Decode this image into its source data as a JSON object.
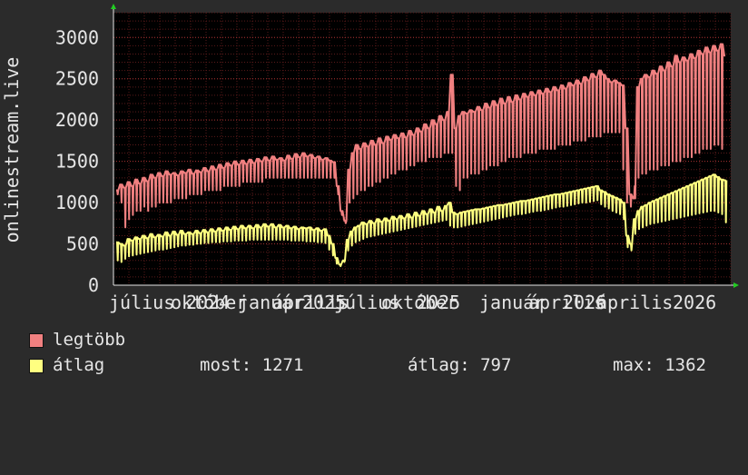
{
  "chart_data": {
    "type": "line",
    "ylabel": "onlinestream.live",
    "ylim": [
      0,
      3300
    ],
    "yticks": [
      0,
      500,
      1000,
      1500,
      2000,
      2500,
      3000
    ],
    "x_tick_labels": [
      "július",
      "október",
      "2024",
      "január",
      "április",
      "2025",
      "július",
      "október",
      "2025",
      "január",
      "április",
      "2026",
      "április",
      "2026"
    ],
    "grid": true,
    "series": [
      {
        "name": "legtöbb",
        "color": "#f08080",
        "values": [
          1150,
          1220,
          1180,
          1250,
          1200,
          1280,
          1230,
          1300,
          1260,
          1340,
          1300,
          1360,
          1320,
          1380,
          1340,
          1360,
          1330,
          1380,
          1360,
          1400,
          1350,
          1390,
          1370,
          1420,
          1380,
          1440,
          1400,
          1460,
          1420,
          1480,
          1450,
          1500,
          1460,
          1510,
          1470,
          1520,
          1480,
          1530,
          1500,
          1550,
          1510,
          1560,
          1520,
          1540,
          1510,
          1570,
          1530,
          1590,
          1550,
          1600,
          1560,
          1580,
          1540,
          1560,
          1520,
          1540,
          1510,
          1490,
          1200,
          900,
          780,
          1400,
          1600,
          1700,
          1650,
          1720,
          1680,
          1750,
          1700,
          1780,
          1720,
          1800,
          1760,
          1820,
          1780,
          1840,
          1790,
          1870,
          1820,
          1900,
          1860,
          1950,
          1900,
          2000,
          1950,
          2050,
          2000,
          2100,
          2550,
          1900,
          2050,
          2100,
          2080,
          2120,
          2100,
          2160,
          2120,
          2200,
          2150,
          2230,
          2180,
          2260,
          2200,
          2280,
          2220,
          2300,
          2250,
          2320,
          2280,
          2340,
          2300,
          2360,
          2320,
          2380,
          2340,
          2400,
          2360,
          2420,
          2380,
          2450,
          2420,
          2480,
          2440,
          2520,
          2480,
          2560,
          2520,
          2600,
          2550,
          2500,
          2460,
          2480,
          2450,
          2420,
          1900,
          1100,
          1050,
          2400,
          2500,
          2550,
          2520,
          2600,
          2560,
          2650,
          2600,
          2700,
          2650,
          2780,
          2700,
          2760,
          2720,
          2800,
          2750,
          2840,
          2800,
          2880,
          2820,
          2900,
          2840,
          2920,
          2780
        ],
        "lows": [
          1100,
          1000,
          700,
          800,
          850,
          900,
          900,
          950,
          900,
          950,
          950,
          1000,
          1000,
          1000,
          1000,
          1050,
          1050,
          1050,
          1050,
          1100,
          1100,
          1100,
          1100,
          1150,
          1150,
          1150,
          1150,
          1150,
          1200,
          1200,
          1200,
          1200,
          1200,
          1250,
          1250,
          1250,
          1250,
          1250,
          1250,
          1300,
          1300,
          1300,
          1300,
          1300,
          1300,
          1300,
          1300,
          1300,
          1300,
          1300,
          1300,
          1300,
          1300,
          1300,
          1300,
          1300,
          1300,
          1300,
          1100,
          850,
          750,
          1000,
          1050,
          1100,
          1150,
          1150,
          1200,
          1200,
          1250,
          1250,
          1300,
          1300,
          1350,
          1350,
          1400,
          1400,
          1400,
          1450,
          1450,
          1500,
          1500,
          1500,
          1550,
          1550,
          1550,
          1550,
          1600,
          1600,
          1600,
          1200,
          1150,
          1300,
          1300,
          1350,
          1350,
          1350,
          1400,
          1400,
          1450,
          1450,
          1450,
          1500,
          1500,
          1550,
          1550,
          1550,
          1550,
          1600,
          1600,
          1600,
          1600,
          1650,
          1650,
          1650,
          1650,
          1650,
          1700,
          1700,
          1700,
          1700,
          1750,
          1750,
          1750,
          1750,
          1800,
          1800,
          1800,
          1800,
          1850,
          1850,
          1850,
          1850,
          1850,
          1400,
          1000,
          950,
          1200,
          1300,
          1350,
          1350,
          1400,
          1400,
          1400,
          1450,
          1450,
          1450,
          1500,
          1500,
          1500,
          1550,
          1550,
          1550,
          1600,
          1600,
          1650,
          1650,
          1650,
          1700,
          1700,
          1650
        ]
      },
      {
        "name": "átlag",
        "color": "#ffff80",
        "values": [
          520,
          500,
          480,
          560,
          540,
          580,
          560,
          600,
          570,
          620,
          580,
          610,
          590,
          640,
          600,
          650,
          610,
          660,
          620,
          640,
          620,
          660,
          630,
          670,
          640,
          680,
          650,
          690,
          660,
          700,
          670,
          710,
          680,
          720,
          690,
          720,
          690,
          730,
          700,
          740,
          710,
          740,
          700,
          730,
          700,
          720,
          690,
          710,
          680,
          700,
          690,
          700,
          670,
          690,
          660,
          680,
          600,
          500,
          330,
          250,
          300,
          550,
          650,
          700,
          720,
          760,
          740,
          780,
          750,
          800,
          770,
          810,
          780,
          830,
          800,
          840,
          810,
          860,
          820,
          880,
          840,
          900,
          860,
          920,
          880,
          950,
          900,
          960,
          1000,
          880,
          860,
          880,
          890,
          900,
          910,
          920,
          920,
          930,
          940,
          950,
          960,
          970,
          970,
          980,
          990,
          1000,
          1010,
          1020,
          1020,
          1030,
          1040,
          1050,
          1060,
          1070,
          1080,
          1090,
          1100,
          1100,
          1110,
          1120,
          1130,
          1140,
          1150,
          1160,
          1170,
          1180,
          1190,
          1200,
          1150,
          1130,
          1100,
          1080,
          1060,
          1040,
          1000,
          600,
          500,
          800,
          900,
          950,
          970,
          1000,
          1020,
          1040,
          1060,
          1080,
          1100,
          1120,
          1140,
          1160,
          1180,
          1200,
          1220,
          1240,
          1260,
          1280,
          1300,
          1320,
          1340,
          1310,
          1280,
          1271
        ],
        "lows": [
          300,
          280,
          320,
          350,
          360,
          370,
          380,
          390,
          400,
          410,
          420,
          430,
          430,
          440,
          450,
          460,
          470,
          480,
          480,
          490,
          490,
          500,
          500,
          510,
          510,
          520,
          520,
          520,
          530,
          530,
          530,
          540,
          540,
          540,
          540,
          550,
          550,
          550,
          550,
          550,
          550,
          550,
          550,
          550,
          550,
          550,
          540,
          540,
          540,
          540,
          530,
          530,
          530,
          520,
          520,
          510,
          430,
          360,
          260,
          230,
          280,
          420,
          480,
          520,
          540,
          560,
          580,
          590,
          600,
          610,
          620,
          630,
          640,
          650,
          660,
          670,
          680,
          690,
          700,
          710,
          720,
          730,
          740,
          750,
          760,
          770,
          780,
          790,
          720,
          700,
          700,
          710,
          720,
          730,
          740,
          750,
          760,
          770,
          780,
          790,
          800,
          810,
          820,
          830,
          840,
          850,
          860,
          860,
          870,
          880,
          890,
          900,
          900,
          910,
          920,
          930,
          940,
          950,
          950,
          960,
          970,
          980,
          990,
          1000,
          1000,
          1010,
          1020,
          1030,
          980,
          950,
          930,
          900,
          880,
          860,
          800,
          460,
          420,
          620,
          680,
          700,
          720,
          740,
          750,
          760,
          770,
          780,
          790,
          800,
          810,
          820,
          830,
          840,
          850,
          860,
          870,
          880,
          890,
          900,
          900,
          880,
          860,
          760
        ]
      }
    ]
  },
  "legend": [
    {
      "label": "legtöbb",
      "color": "#f08080"
    },
    {
      "label": "átlag",
      "color": "#ffff80"
    }
  ],
  "stats": {
    "now": "most: 1271",
    "avg": "átlag: 797",
    "max": "max: 1362"
  }
}
